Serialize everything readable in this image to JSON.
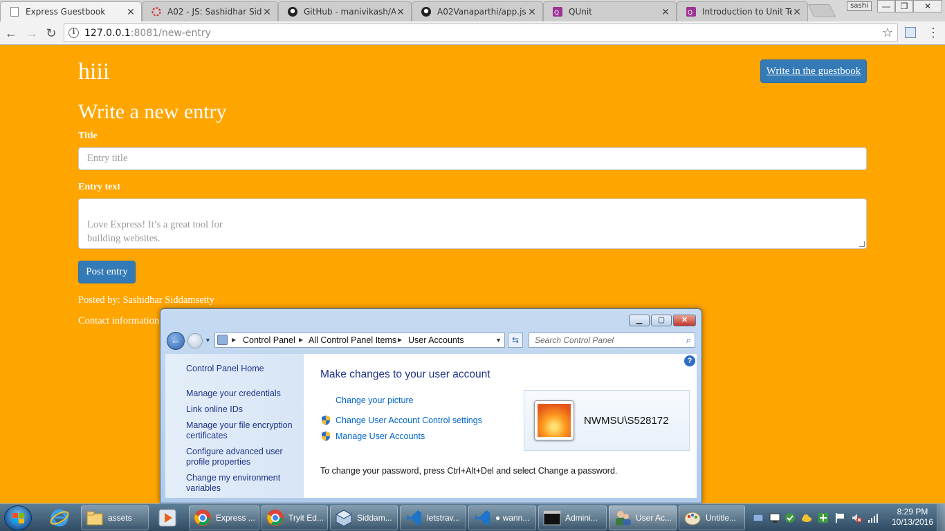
{
  "browser": {
    "tabs": [
      {
        "title": "Express Guestbook",
        "icon": "page-icon",
        "active": true
      },
      {
        "title": "A02 - JS: Sashidhar Sidda",
        "icon": "loading-icon"
      },
      {
        "title": "GitHub - manivikash/A02",
        "icon": "github-icon"
      },
      {
        "title": "A02Vanaparthi/app.js at",
        "icon": "github-icon"
      },
      {
        "title": "QUnit",
        "icon": "qunit-icon"
      },
      {
        "title": "Introduction to Unit Test",
        "icon": "qunit-icon"
      }
    ],
    "profile_label": "sashi",
    "url_host": "127.0.0.1",
    "url_rest": ":8081/new-entry"
  },
  "page": {
    "brand": "hiii",
    "write_link": "Write in the guestbook",
    "heading": "Write a new entry",
    "title_label": "Title",
    "title_placeholder": "Entry title",
    "text_label": "Entry text",
    "text_placeholder": "Love Express! It’s a great tool for\nbuilding websites.",
    "post_button": "Post entry",
    "posted_by": "Posted by: Sashidhar Siddamsetty",
    "contact": "Contact information:"
  },
  "control_panel": {
    "breadcrumb": [
      "Control Panel",
      "All Control Panel Items",
      "User Accounts"
    ],
    "search_placeholder": "Search Control Panel",
    "left_links": [
      "Control Panel Home",
      "Manage your credentials",
      "Link online IDs",
      "Manage your file encryption certificates",
      "Configure advanced user profile properties",
      "Change my environment variables"
    ],
    "heading": "Make changes to your user account",
    "actions": [
      "Change your picture",
      "Change User Account Control settings",
      "Manage User Accounts"
    ],
    "account_name": "NWMSU\\S528172",
    "password_hint": "To change your password, press Ctrl+Alt+Del and select Change a password."
  },
  "taskbar": {
    "items": [
      {
        "label": "assets",
        "icon": "folder-icon"
      },
      {
        "label": "Express ...",
        "icon": "chrome-icon"
      },
      {
        "label": "Tryit Ed...",
        "icon": "chrome-icon"
      },
      {
        "label": "Siddam...",
        "icon": "virtualbox-icon"
      },
      {
        "label": "letstrav...",
        "icon": "vscode-icon"
      },
      {
        "label": "● wann...",
        "icon": "vscode-icon"
      },
      {
        "label": "Admini...",
        "icon": "cmd-icon"
      },
      {
        "label": "User Ac...",
        "icon": "user-accounts-icon"
      },
      {
        "label": "Untitle...",
        "icon": "paint-icon"
      }
    ],
    "time": "8:29 PM",
    "date": "10/13/2016"
  },
  "colors": {
    "page_background": "#FFA500",
    "primary_button": "#337AB7"
  }
}
